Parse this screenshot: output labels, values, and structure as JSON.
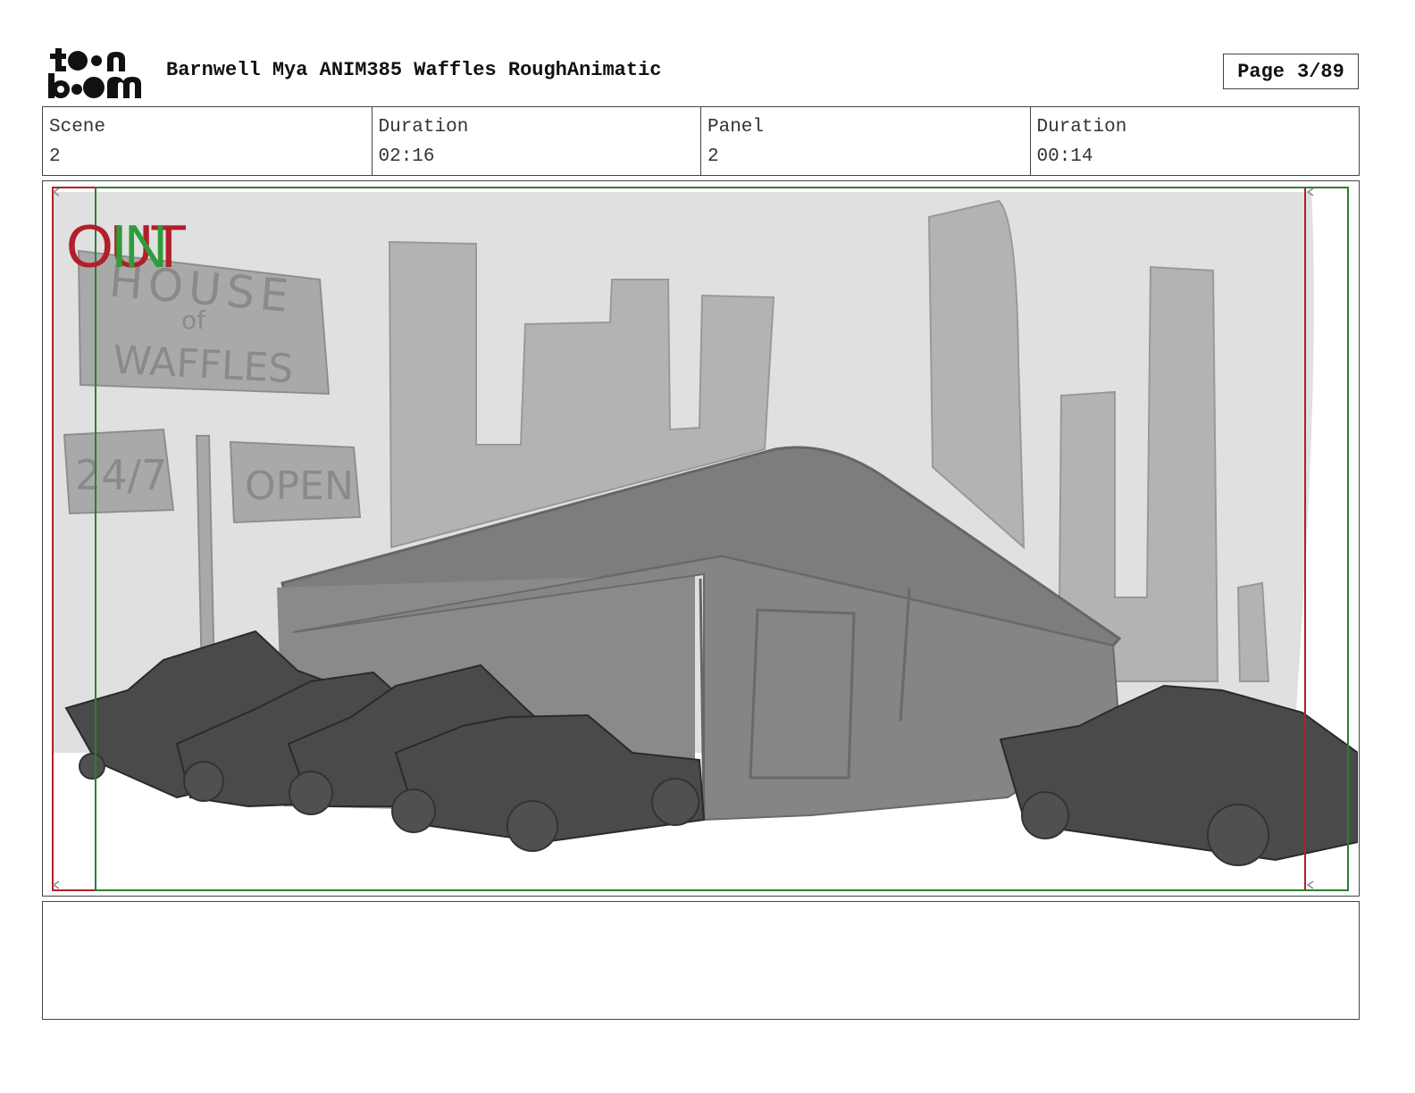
{
  "header": {
    "logo_text": "toon boom",
    "document_title": "Barnwell Mya ANIM385 Waffles RoughAnimatic",
    "page_label": "Page",
    "page_number": "3/89"
  },
  "info": {
    "scene_label": "Scene",
    "scene_value": "2",
    "scene_duration_label": "Duration",
    "scene_duration_value": "02:16",
    "panel_label": "Panel",
    "panel_value": "2",
    "panel_duration_label": "Duration",
    "panel_duration_value": "00:14"
  },
  "panel": {
    "out_marker": "OUT",
    "in_marker": "IN",
    "sign_house": "HOUSE",
    "sign_of": "of",
    "sign_waffles": "WAFFLES",
    "sign_hours": "24/7",
    "sign_open": "OPEN",
    "colors": {
      "out_frame": "#b0202a",
      "in_frame": "#2e7d32",
      "sky": "#e0e0e0",
      "buildings": "#b3b3b3",
      "diner": "#808080",
      "cars": "#4a4a4a"
    }
  },
  "notes": {
    "text": ""
  }
}
